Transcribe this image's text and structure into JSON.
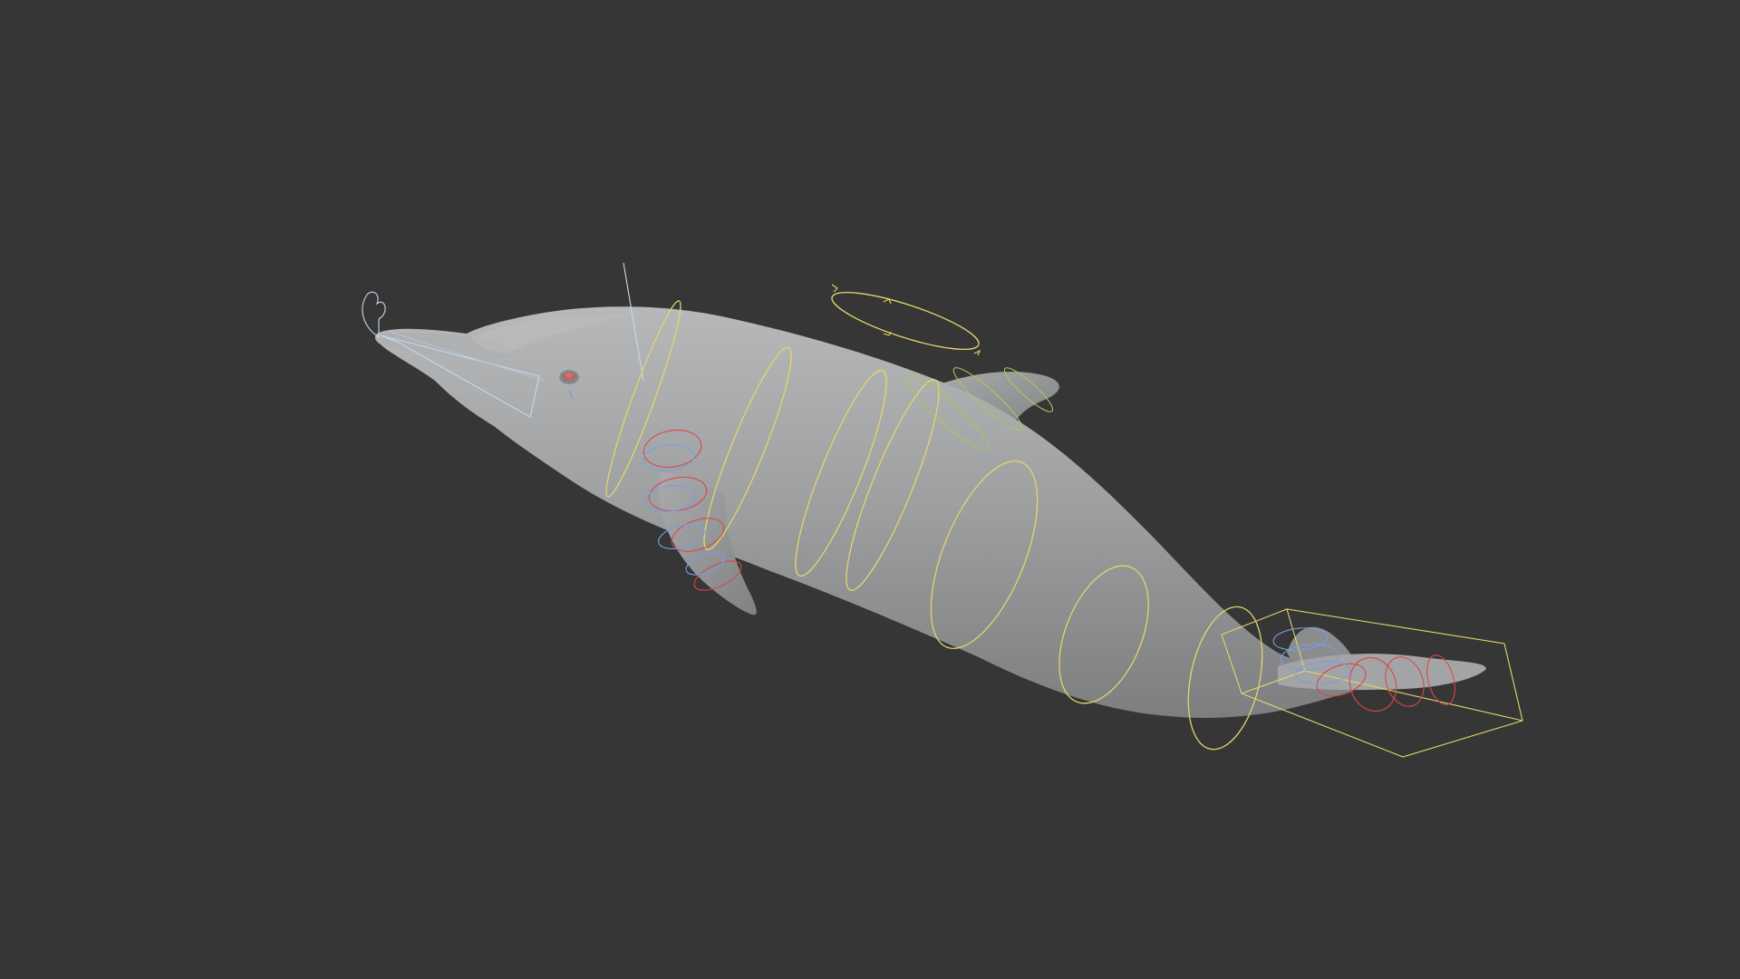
{
  "viewport": {
    "background": "#363636",
    "object": "dolphin-mesh",
    "mesh_color": "#9a9c9e",
    "rig_colors": {
      "main_controls": "#e2d66a",
      "dorsal_controls": "#a8c85a",
      "left_side_controls": "#d94848",
      "right_side_controls": "#7a9ee0",
      "head_controls": "#c9d8ea"
    }
  }
}
